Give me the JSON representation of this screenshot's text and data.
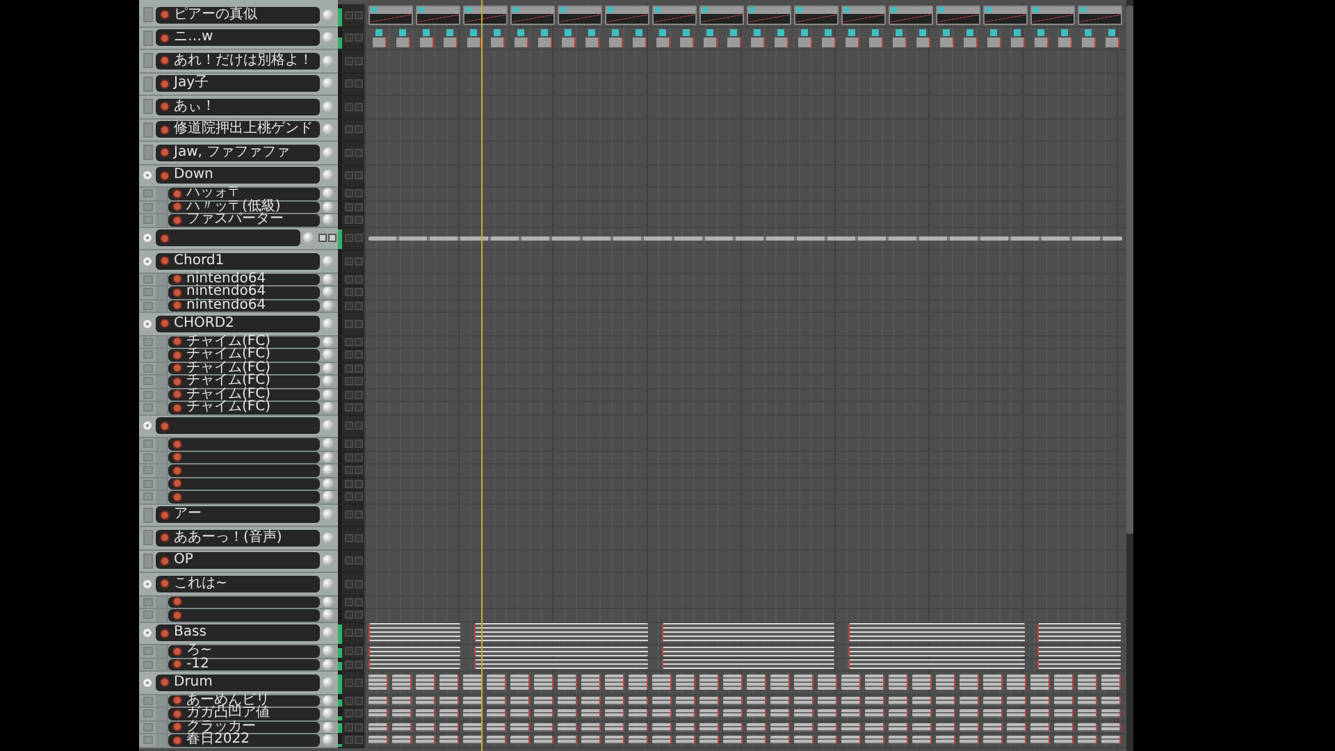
{
  "tracks": [
    {
      "kind": "track",
      "name": "ピアーの真似",
      "level": 0.8,
      "lane": {
        "kind": "theme"
      }
    },
    {
      "kind": "track",
      "name": "ニ…w",
      "level": 0.5,
      "lane": {
        "kind": "small"
      }
    },
    {
      "kind": "track",
      "name": "あれ！だけは別格よ！"
    },
    {
      "kind": "track",
      "name": "Jay子"
    },
    {
      "kind": "track",
      "name": "あぃ！"
    },
    {
      "kind": "track",
      "name": "修道院押出上桃ゲンド"
    },
    {
      "kind": "track",
      "name": "Jaw, ファファファ"
    },
    {
      "kind": "folder",
      "name": "Down",
      "children": [
        {
          "kind": "track",
          "name": "ハッォ〒"
        },
        {
          "kind": "track",
          "name": "ハ〃ッ〒(低級)"
        },
        {
          "kind": "track",
          "name": "ファスパーター"
        }
      ]
    },
    {
      "kind": "collapsed-folder",
      "level": 0.9,
      "lane": {
        "kind": "line"
      }
    },
    {
      "kind": "folder",
      "name": "Chord1",
      "children": [
        {
          "kind": "track",
          "name": "nintendo64"
        },
        {
          "kind": "track",
          "name": "nintendo64"
        },
        {
          "kind": "track",
          "name": "nintendo64"
        }
      ]
    },
    {
      "kind": "folder",
      "name": "CHORD2",
      "children": [
        {
          "kind": "track",
          "name": "チャイム(FC)"
        },
        {
          "kind": "track",
          "name": "チャイム(FC)"
        },
        {
          "kind": "track",
          "name": "チャイム(FC)"
        },
        {
          "kind": "track",
          "name": "チャイム(FC)"
        },
        {
          "kind": "track",
          "name": "チャイム(FC)"
        },
        {
          "kind": "track",
          "name": "チャイム(FC)"
        }
      ]
    },
    {
      "kind": "folder",
      "children": [
        {
          "kind": "track"
        },
        {
          "kind": "track"
        },
        {
          "kind": "track"
        },
        {
          "kind": "track"
        },
        {
          "kind": "track"
        }
      ]
    },
    {
      "kind": "track",
      "name": "アー"
    },
    {
      "kind": "track",
      "name": "ああーっ！(音声)"
    },
    {
      "kind": "track",
      "name": "OP"
    },
    {
      "kind": "folder",
      "name": "これは~",
      "children": [
        {
          "kind": "track"
        },
        {
          "kind": "track"
        }
      ]
    },
    {
      "kind": "folder",
      "name": "Bass",
      "level": 0.9,
      "lane": {
        "kind": "notes"
      },
      "children": [
        {
          "kind": "track",
          "name": "ろ~",
          "level": 0.8,
          "lane": {
            "kind": "notes"
          }
        },
        {
          "kind": "track",
          "name": "-12",
          "level": 0.7,
          "lane": {
            "kind": "notes"
          }
        }
      ]
    },
    {
      "kind": "folder",
      "name": "Drum",
      "level": 0.9,
      "lane": {
        "kind": "hits"
      },
      "children": [
        {
          "kind": "track",
          "name": "あーめんビリ",
          "level": 0.6,
          "lane": {
            "kind": "hits"
          }
        },
        {
          "kind": "track",
          "name": "ガガ凸凹ア値",
          "level": 0.3,
          "lane": {
            "kind": "hits"
          }
        },
        {
          "kind": "track",
          "name": "クラッカー",
          "level": 0.8,
          "lane": {
            "kind": "hits"
          }
        },
        {
          "kind": "track",
          "name": "春日2022",
          "level": 0.2,
          "lane": {
            "kind": "hits"
          }
        }
      ]
    }
  ]
}
